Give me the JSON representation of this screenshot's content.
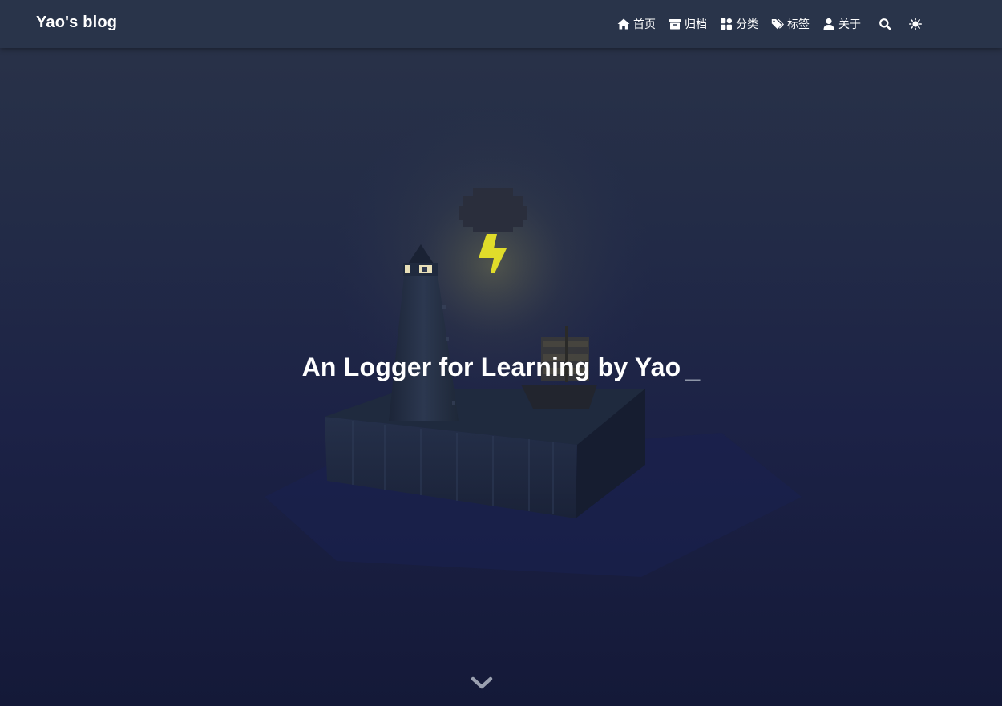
{
  "navbar": {
    "brand": "Yao's blog",
    "items": [
      {
        "label": "首页",
        "icon": "home-icon"
      },
      {
        "label": "归档",
        "icon": "archive-icon"
      },
      {
        "label": "分类",
        "icon": "category-icon"
      },
      {
        "label": "标签",
        "icon": "tags-icon"
      },
      {
        "label": "关于",
        "icon": "user-icon"
      }
    ],
    "search_icon": "search-icon",
    "theme_icon": "sun-icon"
  },
  "hero": {
    "title": "An Logger for Learning by Yao",
    "cursor": "_"
  },
  "scroll_icon": "chevron-down-icon",
  "colors": {
    "navbar_bg": "#29344a",
    "lightning": "#e0dc2a",
    "text": "#ffffff"
  }
}
